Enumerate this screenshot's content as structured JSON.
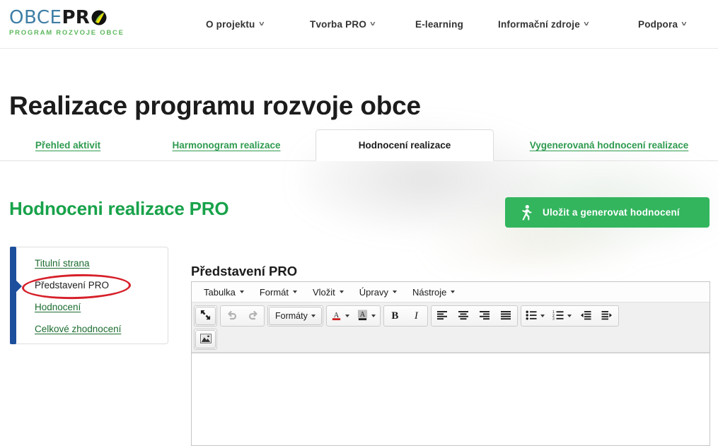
{
  "header": {
    "logo": {
      "part1": "OBCE",
      "part2": "PR",
      "tagline": "PROGRAM ROZVOJE OBCE"
    },
    "nav": [
      {
        "label": "O projektu",
        "has_caret": true
      },
      {
        "label": "Tvorba PRO",
        "has_caret": true
      },
      {
        "label": "E-learning",
        "has_caret": false
      },
      {
        "label": "Informační zdroje",
        "has_caret": true
      },
      {
        "label": "Podpora",
        "has_caret": true
      }
    ]
  },
  "page": {
    "title": "Realizace programu rozvoje obce",
    "section_title": "Hodnoceni realizace PRO"
  },
  "tabs": [
    {
      "label": "Přehled aktivit",
      "active": false
    },
    {
      "label": "Harmonogram realizace",
      "active": false
    },
    {
      "label": "Hodnocení realizace",
      "active": true
    },
    {
      "label": "Vygenerovaná hodnocení realizace",
      "active": false
    }
  ],
  "save_button": {
    "label": "Uložit a generovat hodnocení",
    "icon": "running-person-icon",
    "color": "#33b55e"
  },
  "sidebar": {
    "items": [
      {
        "label": "Titulní strana",
        "active": false
      },
      {
        "label": "Představení PRO",
        "active": true
      },
      {
        "label": "Hodnocení",
        "active": false
      },
      {
        "label": "Celkové zhodnocení",
        "active": false
      }
    ],
    "rail_color": "#1d4f9c",
    "highlight_color": "#d6202a"
  },
  "editor": {
    "heading": "Představení PRO",
    "menu": [
      {
        "label": "Tabulka"
      },
      {
        "label": "Formát"
      },
      {
        "label": "Vložit"
      },
      {
        "label": "Úpravy"
      },
      {
        "label": "Nástroje"
      }
    ],
    "toolbar": {
      "fullscreen": "fullscreen-icon",
      "undo": "undo-icon",
      "redo": "redo-icon",
      "formats_label": "Formáty",
      "text_color": "text-color-icon",
      "background_color": "background-color-icon",
      "bold": "B",
      "italic": "I",
      "align_left": "align-left-icon",
      "align_center": "align-center-icon",
      "align_right": "align-right-icon",
      "align_justify": "align-justify-icon",
      "bullet_list": "bullet-list-icon",
      "numbered_list": "numbered-list-icon",
      "outdent": "outdent-icon",
      "indent": "indent-icon",
      "insert_image": "insert-image-icon"
    },
    "content": ""
  }
}
